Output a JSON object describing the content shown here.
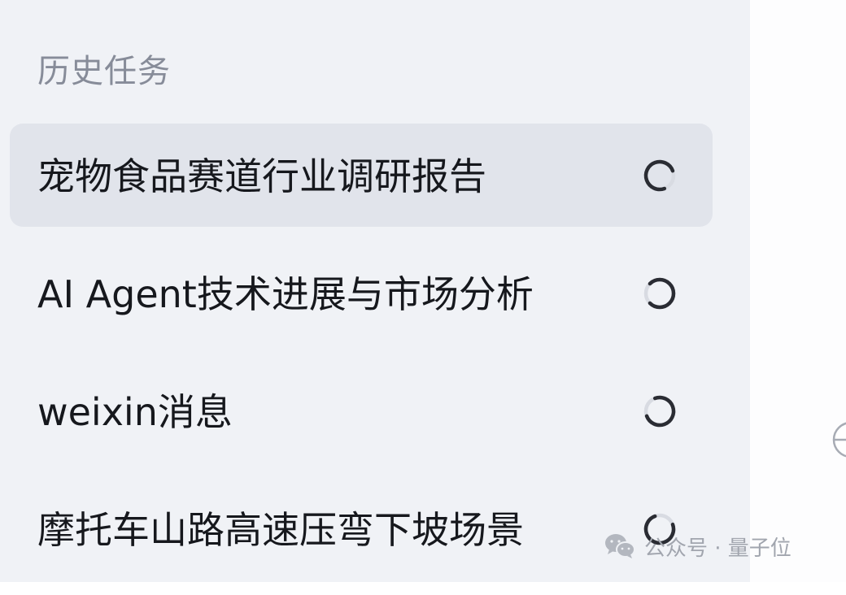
{
  "sidebar": {
    "section_title": "历史任务",
    "tasks": [
      {
        "title": "宠物食品赛道行业调研报告",
        "status": "loading-spinner-icon"
      },
      {
        "title": "AI Agent技术进展与市场分析",
        "status": "loading-spinner-icon"
      },
      {
        "title": "weixin消息",
        "status": "loading-spinner-icon"
      },
      {
        "title": "摩托车山路高速压弯下坡场景",
        "status": "loading-spinner-icon"
      }
    ]
  },
  "watermark": {
    "text": "公众号 · 量子位",
    "icon": "wechat-icon"
  },
  "colors": {
    "sidebar_bg": "#f0f2f6",
    "active_item_bg": "#e1e4eb",
    "title_gray": "#878c99",
    "text_dark": "#16181d"
  }
}
